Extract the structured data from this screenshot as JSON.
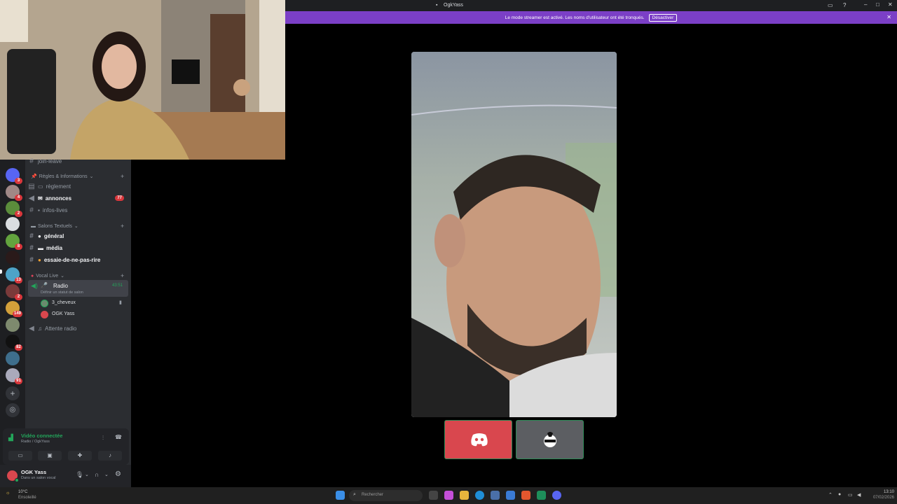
{
  "window": {
    "title": "OgkYass"
  },
  "banner": {
    "text": "Le mode streamer est activé. Les noms d'utilisateur ont été tronqués.",
    "button": "Désactiver"
  },
  "channels": {
    "partial_top": "join-leave",
    "cat_rules": "Règles & Informations",
    "reglement": "règlement",
    "annonces": "annonces",
    "annonces_badge": "77",
    "infos_lives": "infos-lives",
    "cat_text": "Salons Textuels",
    "general": "général",
    "media": "média",
    "essaie": "essaie-de-ne-pas-rire",
    "cat_vocal": "Vocal Live",
    "radio": "Radio",
    "radio_timer": "43:51",
    "radio_status": "Définir un statut de salon",
    "member1": "3_cheveux",
    "member2": "OGK Yass",
    "attente": "Attente radio"
  },
  "server_badges": [
    "3",
    "4",
    "2",
    "8",
    "13",
    "2",
    "149",
    "82",
    "91"
  ],
  "voice": {
    "status": "Vidéo connectée",
    "location": "Radio / OgkYass"
  },
  "user": {
    "name": "OGK Yass",
    "status": "Dans un salon vocal"
  },
  "taskbar": {
    "weather_temp": "10°C",
    "weather_desc": "Ensoleillé",
    "search": "Rechercher",
    "time": "13:10",
    "date": "07/02/2026"
  },
  "colors": {
    "accent": "#7b3fc6",
    "online": "#23a55a",
    "discord": "#5865f2",
    "tile_red": "#d9474e"
  }
}
